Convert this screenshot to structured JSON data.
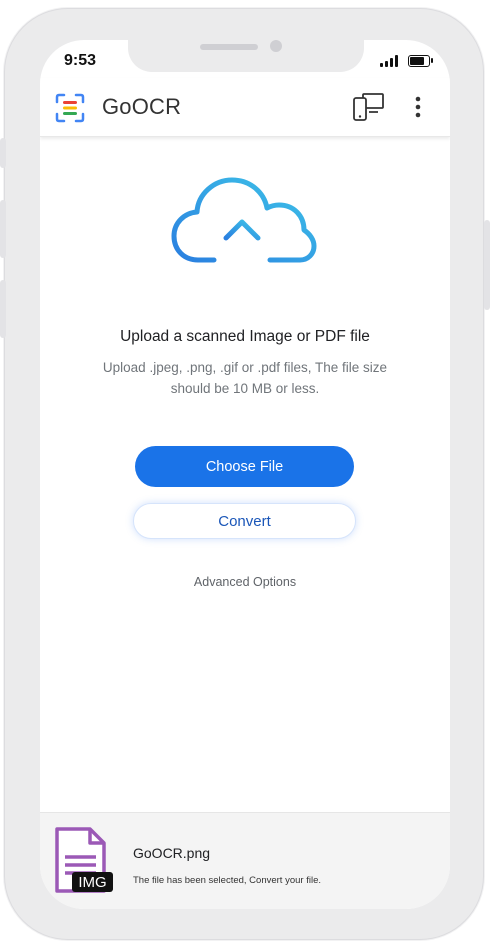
{
  "status_bar": {
    "time": "9:53"
  },
  "app_bar": {
    "title": "GoOCR",
    "device_icon": "device-switch-icon",
    "menu_icon": "more-vert-icon"
  },
  "upload": {
    "icon": "cloud-upload-icon",
    "title": "Upload a scanned Image or PDF file",
    "description": "Upload .jpeg, .png, .gif or .pdf files, The file size should be 10 MB or less."
  },
  "actions": {
    "choose_file": "Choose File",
    "convert": "Convert",
    "advanced": "Advanced Options"
  },
  "selected_file": {
    "icon": "document-icon",
    "badge": "IMG",
    "name": "GoOCR.png",
    "status": "The file has been selected, Convert your file."
  },
  "colors": {
    "primary": "#1a73e8",
    "file_icon": "#9b59b6",
    "cloud_start": "#2a7fe0",
    "cloud_end": "#3ec4e8"
  }
}
